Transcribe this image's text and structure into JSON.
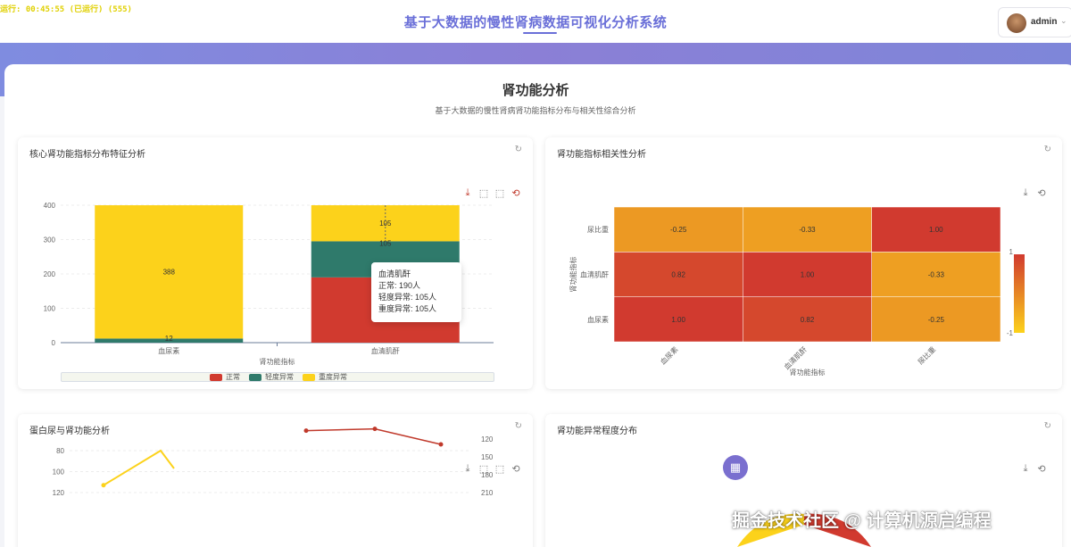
{
  "header": {
    "runtime": "运行: 00:45:55 (已运行) (555)",
    "system_title": "基于大数据的慢性肾病数据可视化分析系统",
    "user": "admin"
  },
  "page": {
    "title": "肾功能分析",
    "subtitle": "基于大数据的慢性肾病肾功能指标分布与相关性综合分析"
  },
  "panels": {
    "p1": {
      "title": "核心肾功能指标分布特征分析"
    },
    "p2": {
      "title": "肾功能指标相关性分析"
    },
    "p3": {
      "title": "蛋白尿与肾功能分析"
    },
    "p4": {
      "title": "肾功能异常程度分布"
    }
  },
  "icons": {
    "refresh": "↻",
    "download": "⤓",
    "zoom": "⬚",
    "restore": "⟲",
    "chevron": "⌄",
    "grid": "▦"
  },
  "tooltip": {
    "title": "血清肌酐",
    "rows": [
      "正常: 190人",
      "轻度异常: 105人",
      "重度异常: 105人"
    ]
  },
  "watermark": "掘金技术社区 @ 计算机源启编程",
  "chart_data": [
    {
      "type": "bar",
      "stacked": true,
      "title": "",
      "xlabel": "肾功能指标",
      "ylabel": "",
      "ylim": [
        0,
        400
      ],
      "yticks": [
        0,
        100,
        200,
        300,
        400
      ],
      "categories": [
        "血尿素",
        "血清肌酐"
      ],
      "series": [
        {
          "name": "正常",
          "color": "#d13a2f",
          "values": [
            0,
            190
          ]
        },
        {
          "name": "轻度异常",
          "color": "#2f7a6b",
          "values": [
            12,
            105
          ]
        },
        {
          "name": "重度异常",
          "color": "#fcd21b",
          "values": [
            388,
            105
          ]
        }
      ],
      "data_labels": [
        {
          "category": "血尿素",
          "text": "388"
        },
        {
          "category": "血尿素",
          "text": "12"
        },
        {
          "category": "血清肌酐",
          "text": "105"
        },
        {
          "category": "血清肌酐",
          "text": "105"
        }
      ],
      "legend": "bottom"
    },
    {
      "type": "heatmap",
      "title": "",
      "xlabel": "肾功能指标",
      "ylabel": "肾功能指标",
      "x": [
        "血尿素",
        "血清肌酐",
        "尿比重"
      ],
      "y": [
        "血尿素",
        "血清肌酐",
        "尿比重"
      ],
      "values": [
        [
          1.0,
          0.82,
          -0.25
        ],
        [
          0.82,
          1.0,
          -0.33
        ],
        [
          -0.25,
          -0.33,
          1.0
        ]
      ],
      "colorscale": [
        "#fcd21b",
        "#d13a2f"
      ],
      "range": [
        -1,
        1
      ],
      "range_labels": [
        "1",
        "-1"
      ]
    },
    {
      "type": "line",
      "title": "",
      "y_left_ticks": [
        80,
        100,
        120
      ],
      "y_right_ticks": [
        120,
        150,
        180,
        210
      ],
      "series": [
        {
          "color": "#fcd21b",
          "values": [
            113,
            80
          ]
        },
        {
          "color": "#c0392b",
          "values": [
            106,
            106,
            129
          ]
        }
      ]
    }
  ]
}
